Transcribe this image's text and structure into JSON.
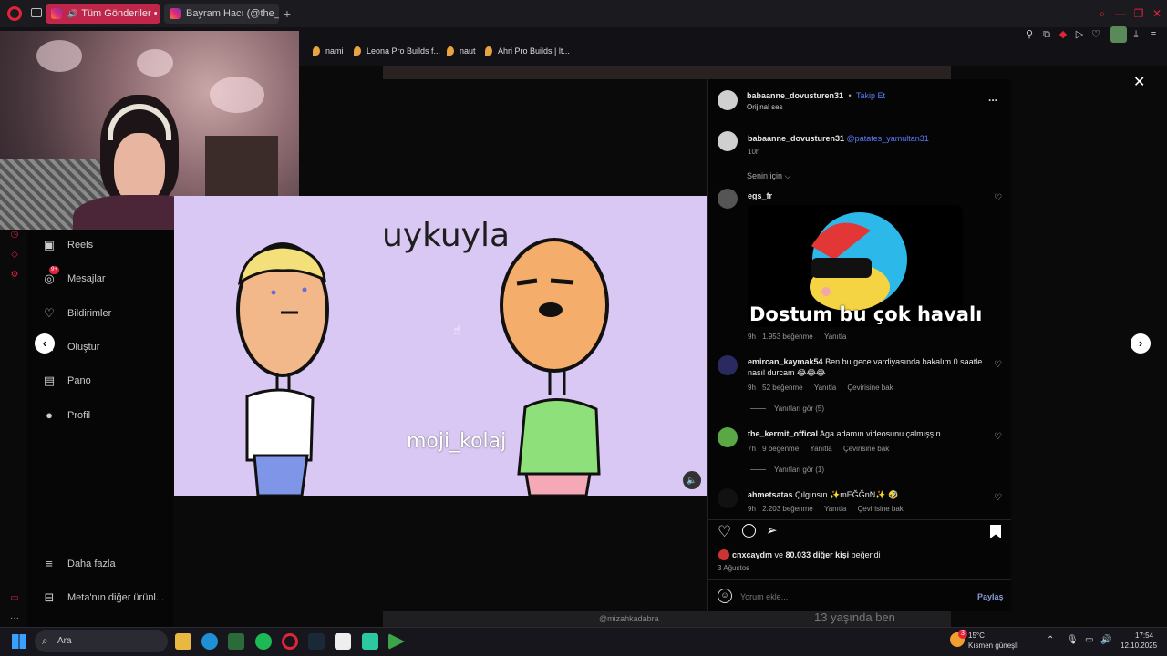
{
  "browser": {
    "tabs": [
      {
        "label": "Tüm Gönderiler • Insta"
      },
      {
        "label": "Bayram Hacı (@the_bayra"
      }
    ],
    "new_tab": "+",
    "bookmarks": [
      {
        "label": "nami"
      },
      {
        "label": "Leona Pro Builds f..."
      },
      {
        "label": "naut"
      },
      {
        "label": "Ahri Pro Builds | lt..."
      }
    ]
  },
  "sidebar": {
    "items": [
      {
        "label": "Reels",
        "icon": "reels-icon"
      },
      {
        "label": "Mesajlar",
        "icon": "messenger-icon",
        "badge": "9+"
      },
      {
        "label": "Bildirimler",
        "icon": "heart-icon"
      },
      {
        "label": "Oluştur",
        "icon": "plus-icon"
      },
      {
        "label": "Pano",
        "icon": "dashboard-icon"
      },
      {
        "label": "Profil",
        "icon": "profile-icon"
      }
    ],
    "more": "Daha fazla",
    "meta": "Meta'nın diğer ürünl..."
  },
  "video": {
    "caption_top": "uykuyla",
    "watermark": "moji_kolaj"
  },
  "post": {
    "author": "babaanne_dovusturen31",
    "separator": "•",
    "follow": "Takip Et",
    "audio": "Orijinal ses",
    "more": "...",
    "caption_user": "babaanne_dovusturen31",
    "caption_mention": "@patates_yamultan31",
    "caption_time": "10h",
    "filter": "Senin için ⌵",
    "comments": [
      {
        "user": "egs_fr",
        "text": "",
        "gif_caption": "Dostum bu çok havalı",
        "time": "9h",
        "likes": "1.953 beğenme",
        "reply": "Yanıtla",
        "translate": "",
        "replies": ""
      },
      {
        "user": "emircan_kaymak54",
        "text": "Ben bu gece vardiyasında bakalım 0 saatle",
        "text2": "nasıl durcam 😂😂😂",
        "time": "9h",
        "likes": "52 beğenme",
        "reply": "Yanıtla",
        "translate": "Çevirisine bak",
        "replies": "Yanıtları gör (5)"
      },
      {
        "user": "the_kermit_offical",
        "text": "Aga adamın videosunu çalmışşın",
        "time": "7h",
        "likes": "9 beğenme",
        "reply": "Yanıtla",
        "translate": "Çevirisine bak",
        "replies": "Yanıtları gör (1)"
      },
      {
        "user": "ahmetsatas",
        "text": "Çılgınsın ✨mEĞĞnN✨ 🤣",
        "time": "9h",
        "likes": "2.203 beğenme",
        "reply": "Yanıtla",
        "translate": "Çevirisine bak",
        "replies": ""
      }
    ],
    "liked_by_user": "cnxcaydm",
    "liked_by_mid": " ve ",
    "liked_by_count": "80.033 diğer kişi",
    "liked_by_end": " beğendi",
    "date": "3 Ağustos",
    "comment_placeholder": "Yorum ekle...",
    "share": "Paylaş"
  },
  "below_text": "@mizahkadabra",
  "below_text2": "13 yaşında ben",
  "taskbar": {
    "search": "Ara",
    "weather_temp": "15°C",
    "weather_desc": "Kısmen güneşli",
    "weather_badge": "3",
    "time": "17:54",
    "date": "12.10.2025"
  }
}
